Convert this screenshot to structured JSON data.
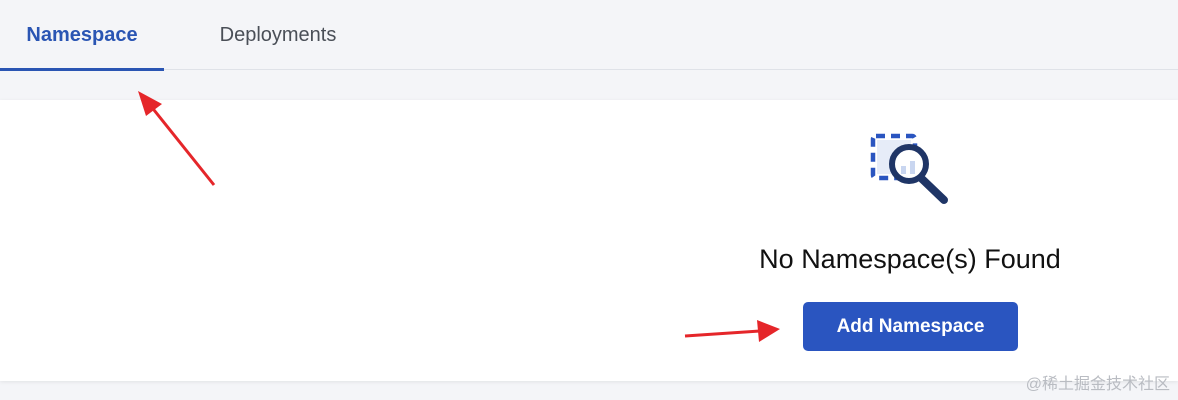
{
  "tabs": [
    {
      "label": "Namespace",
      "active": true
    },
    {
      "label": "Deployments",
      "active": false
    }
  ],
  "empty_state": {
    "icon": "search-icon",
    "title": "No Namespace(s) Found",
    "button_label": "Add Namespace"
  },
  "annotations": {
    "arrow_color": "#e5262a"
  },
  "watermark": "@稀土掘金技术社区",
  "colors": {
    "accent": "#2a55b3",
    "button": "#2a55c0"
  }
}
